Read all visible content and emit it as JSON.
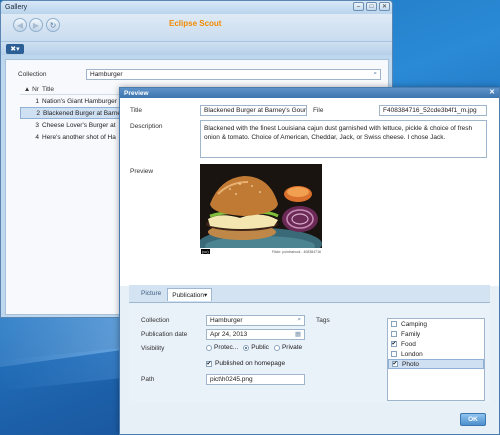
{
  "gallery": {
    "window_title": "Gallery",
    "brand": "Eclipse Scout",
    "collection_label": "Collection",
    "collection_value": "Hamburger",
    "table": {
      "columns": [
        "Nr",
        "Title"
      ],
      "rows": [
        {
          "nr": "1",
          "title": "Nation's Giant Hamburger"
        },
        {
          "nr": "2",
          "title": "Blackened Burger at Barney's"
        },
        {
          "nr": "3",
          "title": "Cheese Lover's Burger at"
        },
        {
          "nr": "4",
          "title": "Here's another shot of Ha"
        }
      ],
      "selected_row": 1
    }
  },
  "preview": {
    "dialog_title": "Preview",
    "title_label": "Title",
    "title_value": "Blackened Burger at Barney's Gourm",
    "file_label": "File",
    "file_value": "F408384716_52cde3b4f1_m.jpg",
    "description_label": "Description",
    "description_value": "Blackened with the finest Louisiana cajun dust garnished with lettuce, pickle & choice of fresh onion & tomato. Choice of American, Cheddar, Jack, or Swiss cheese. I chose Jack.",
    "preview_label": "Preview",
    "image_credit_cc": "(cc)",
    "image_credit_text": "Flickr: pointnshoot - 408384716",
    "tabs": [
      "Picture",
      "Publication"
    ],
    "active_tab": "Publication",
    "publication": {
      "collection_label": "Collection",
      "collection_value": "Hamburger",
      "date_label": "Publication date",
      "date_value": "Apr 24, 2013",
      "visibility_label": "Visibility",
      "visibility_options": [
        "Protec...",
        "Public",
        "Private"
      ],
      "visibility_selected": "Public",
      "published_label": "Published on homepage",
      "published_checked": true,
      "path_label": "Path",
      "path_value": "pict\\h0245.png",
      "tags_label": "Tags",
      "tags": [
        {
          "label": "Camping",
          "checked": false
        },
        {
          "label": "Family",
          "checked": false
        },
        {
          "label": "Food",
          "checked": true
        },
        {
          "label": "London",
          "checked": false
        },
        {
          "label": "Photo",
          "checked": true
        }
      ]
    },
    "ok_label": "OK"
  },
  "colors": {
    "brand": "#f08a00",
    "accent": "#3e74ae",
    "selection": "#cfe0f3"
  }
}
